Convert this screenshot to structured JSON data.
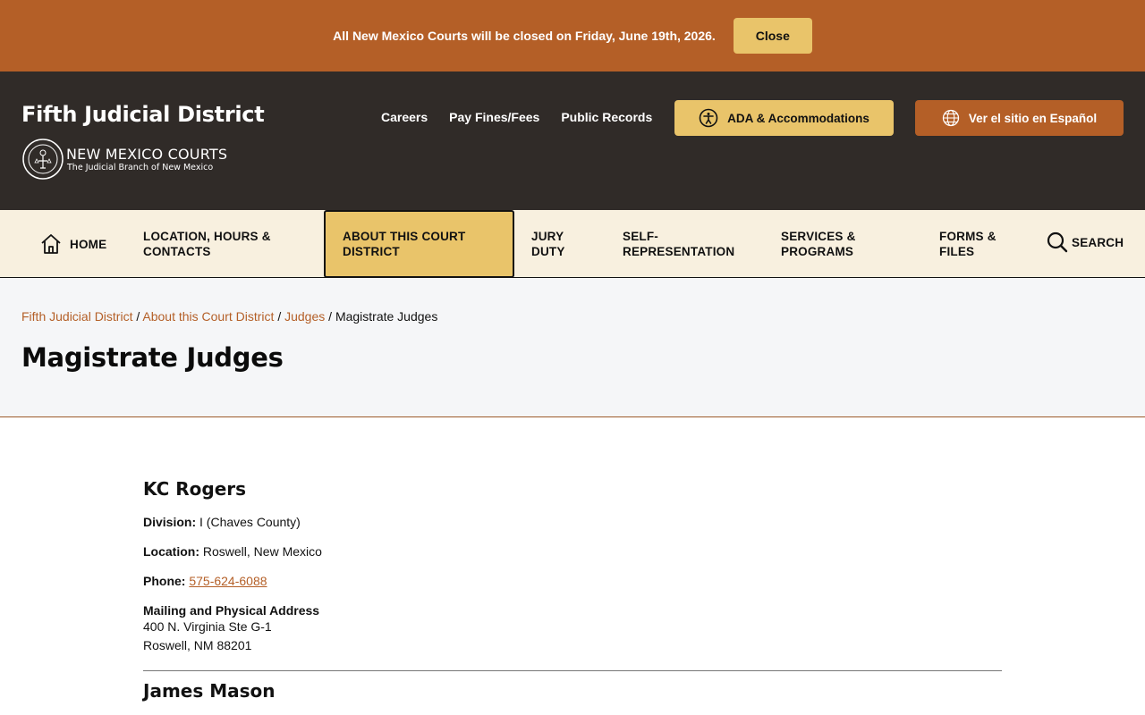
{
  "alert": {
    "message": "All New Mexico Courts will be closed on Friday, June 19th, 2026.",
    "close_label": "Close"
  },
  "header": {
    "site_title": "Fifth Judicial District",
    "logo_name": "NEW MEXICO COURTS",
    "logo_sub": "The Judicial Branch of New Mexico",
    "util_links": [
      "Careers",
      "Pay Fines/Fees",
      "Public Records"
    ],
    "ada_label": "ADA & Accommodations",
    "spanish_label": "Ver el sitio en Español"
  },
  "nav": {
    "home": "HOME",
    "location": [
      "LOCATION, HOURS &",
      "CONTACTS"
    ],
    "about": [
      "ABOUT THIS COURT",
      "DISTRICT"
    ],
    "jury": [
      "JURY",
      "DUTY"
    ],
    "self": [
      "SELF-",
      "REPRESENTATION"
    ],
    "services": [
      "SERVICES &",
      "PROGRAMS"
    ],
    "forms": [
      "FORMS &",
      "FILES"
    ],
    "search": "SEARCH"
  },
  "breadcrumb": {
    "items": [
      "Fifth Judicial District",
      "About this Court District",
      "Judges"
    ],
    "current": "Magistrate Judges",
    "separator": " / "
  },
  "page_title": "Magistrate Judges",
  "judges": [
    {
      "name": "KC Rogers",
      "division_label": "Division:",
      "division": " I (Chaves County)",
      "location_label": "Location:",
      "location": " Roswell, New Mexico",
      "phone_label": "Phone:",
      "phone": "575-624-6088",
      "address_label": "Mailing and Physical Address",
      "address_line1": "400 N. Virginia Ste G-1",
      "address_line2": "Roswell, NM 88201"
    },
    {
      "name": "James Mason"
    }
  ],
  "colors": {
    "accent_orange": "#b45f27",
    "accent_gold": "#e9c46a",
    "header_dark": "#302b28",
    "nav_bg": "#f8f0df"
  }
}
